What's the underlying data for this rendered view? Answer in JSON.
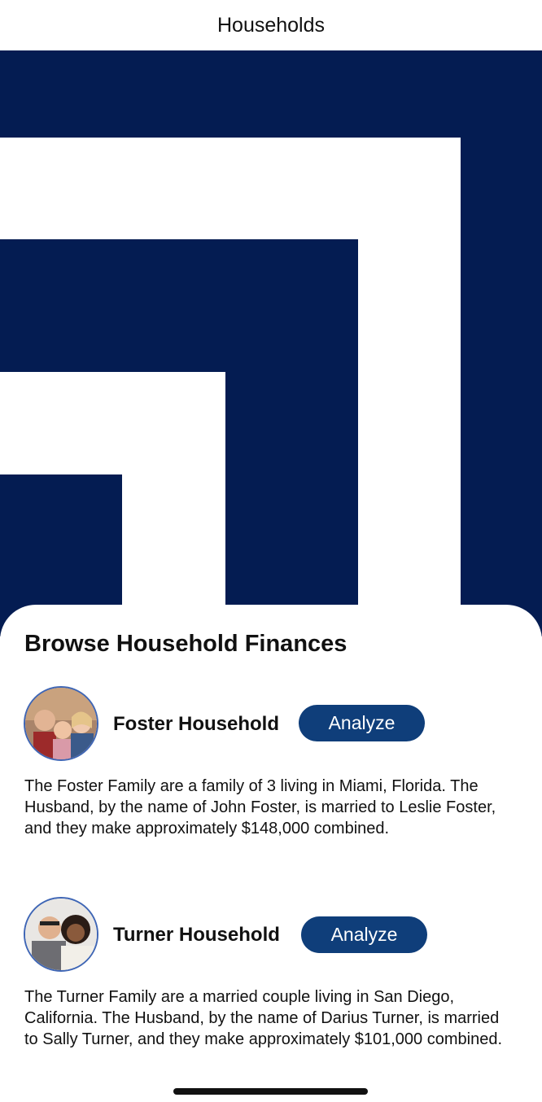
{
  "nav": {
    "title": "Households"
  },
  "hero": {
    "accent": "#041c52",
    "image": "logo-squares"
  },
  "sheet": {
    "title": "Browse Household Finances",
    "households": [
      {
        "name": "Foster Household",
        "button_label": "Analyze",
        "description": "The Foster Family are a family of 3 living in Miami, Florida. The Husband, by the name of John Foster, is married to Leslie Foster, and they make approximately $148,000 combined.",
        "avatar": "family-photo"
      },
      {
        "name": "Turner Household",
        "button_label": "Analyze",
        "description": "The Turner Family are a married couple living in San Diego, California. The Husband, by the name of Darius Turner, is married to Sally Turner, and they make approximately $101,000 combined.",
        "avatar": "couple-photo"
      }
    ]
  },
  "colors": {
    "button": "#0f3e7a",
    "avatar_border": "#3f66b5"
  }
}
